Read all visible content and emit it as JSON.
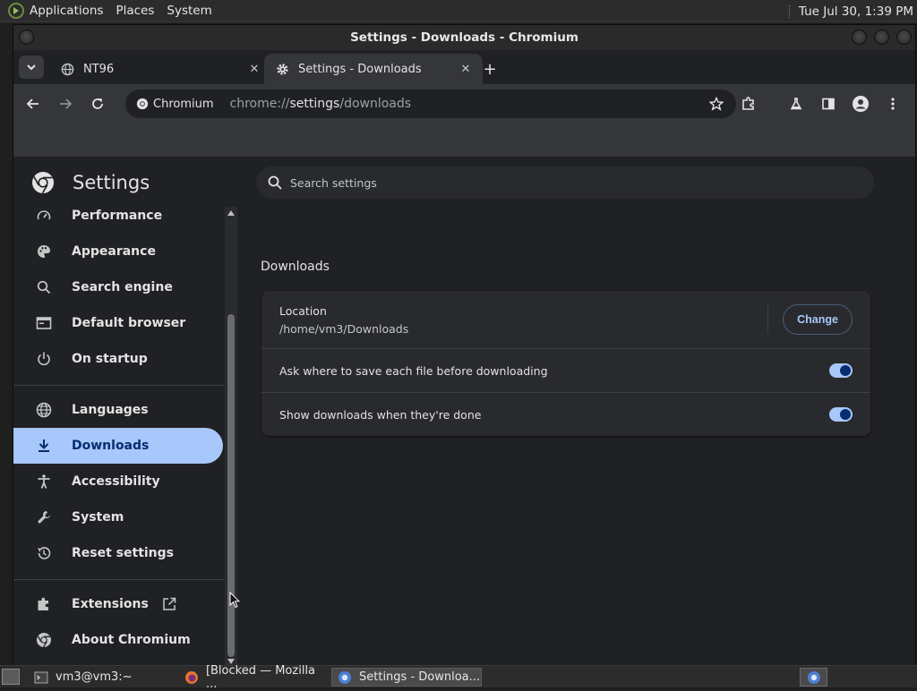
{
  "top_panel": {
    "menus": [
      "Applications",
      "Places",
      "System"
    ],
    "clock": "Tue Jul 30,  1:39 PM"
  },
  "window": {
    "title": "Settings - Downloads - Chromium"
  },
  "tabs": [
    {
      "label": "NT96",
      "favicon": "globe-icon"
    },
    {
      "label": "Settings - Downloads",
      "favicon": "gear-icon"
    }
  ],
  "toolbar": {
    "site_chip": "Chromium",
    "url_prefix": "chrome://",
    "url_host": "settings",
    "url_path": "/downloads"
  },
  "settings": {
    "title": "Settings",
    "search_placeholder": "Search settings",
    "nav": [
      {
        "label": "Performance",
        "icon": "speedometer-icon"
      },
      {
        "label": "Appearance",
        "icon": "palette-icon"
      },
      {
        "label": "Search engine",
        "icon": "search-icon"
      },
      {
        "label": "Default browser",
        "icon": "browser-icon"
      },
      {
        "label": "On startup",
        "icon": "power-icon"
      },
      {
        "label": "Languages",
        "icon": "globe-icon"
      },
      {
        "label": "Downloads",
        "icon": "download-icon",
        "selected": true
      },
      {
        "label": "Accessibility",
        "icon": "accessibility-icon"
      },
      {
        "label": "System",
        "icon": "wrench-icon"
      },
      {
        "label": "Reset settings",
        "icon": "history-icon"
      },
      {
        "label": "Extensions",
        "icon": "puzzle-icon"
      },
      {
        "label": "About Chromium",
        "icon": "chromium-icon"
      }
    ],
    "section_title": "Downloads",
    "location_label": "Location",
    "location_path": "/home/vm3/Downloads",
    "change_label": "Change",
    "ask_where_label": "Ask where to save each file before downloading",
    "ask_where_enabled": true,
    "show_downloads_label": "Show downloads when they're done",
    "show_downloads_enabled": true
  },
  "taskbar": {
    "items": [
      {
        "label": "vm3@vm3:~",
        "icon": "terminal-icon"
      },
      {
        "label": "[Blocked — Mozilla ...",
        "icon": "firefox-icon"
      },
      {
        "label": "Settings - Downloa...",
        "icon": "chromium-icon"
      }
    ]
  },
  "colors": {
    "accent": "#a8c7fa",
    "accent_dark": "#062e6f",
    "page_bg": "#202124",
    "card_bg": "#292a2d"
  }
}
